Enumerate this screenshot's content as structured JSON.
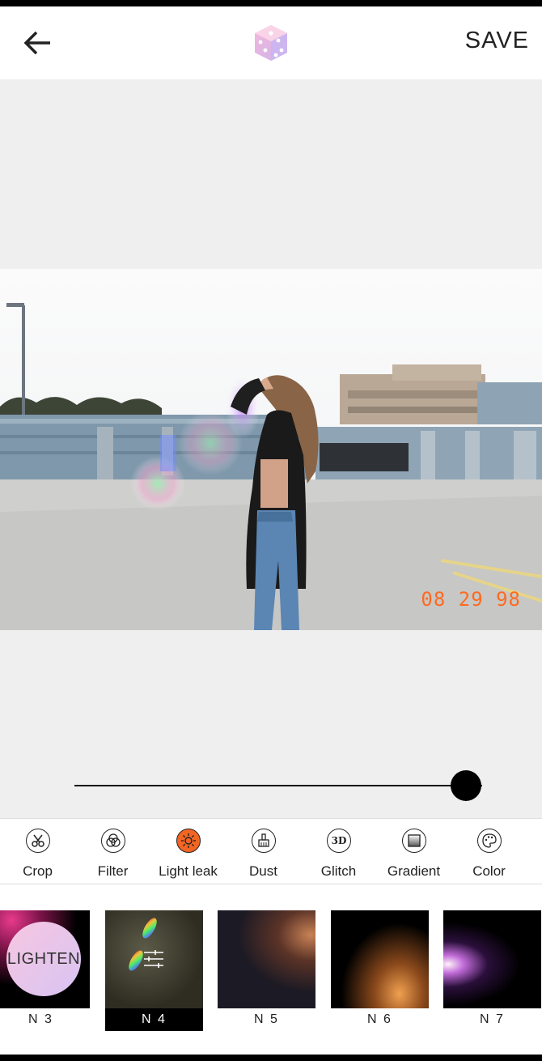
{
  "header": {
    "back_icon": "arrow-left-icon",
    "logo_icon": "dice-icon",
    "save_label": "SAVE"
  },
  "photo": {
    "datestamp": "08 29 98",
    "datestamp_color": "#ff6a1f"
  },
  "slider": {
    "value": 0.96
  },
  "tools": [
    {
      "label": "Crop",
      "icon": "scissors-icon",
      "active": false
    },
    {
      "label": "Filter",
      "icon": "filter-circles-icon",
      "active": false
    },
    {
      "label": "Light leak",
      "icon": "sun-icon",
      "active": true
    },
    {
      "label": "Dust",
      "icon": "dust-brush-icon",
      "active": false
    },
    {
      "label": "Glitch",
      "icon": "3d-icon",
      "active": false,
      "icon_text": "3D"
    },
    {
      "label": "Gradient",
      "icon": "gradient-square-icon",
      "active": false
    },
    {
      "label": "Color",
      "icon": "palette-icon",
      "active": false
    }
  ],
  "presets": [
    {
      "name": "N 3",
      "overlay": "LIGHTEN"
    },
    {
      "name": "N 4",
      "selected": true
    },
    {
      "name": "N 5"
    },
    {
      "name": "N 6"
    },
    {
      "name": "N 7"
    }
  ],
  "colors": {
    "accent": "#f26522",
    "canvas_bg": "#efefef"
  }
}
